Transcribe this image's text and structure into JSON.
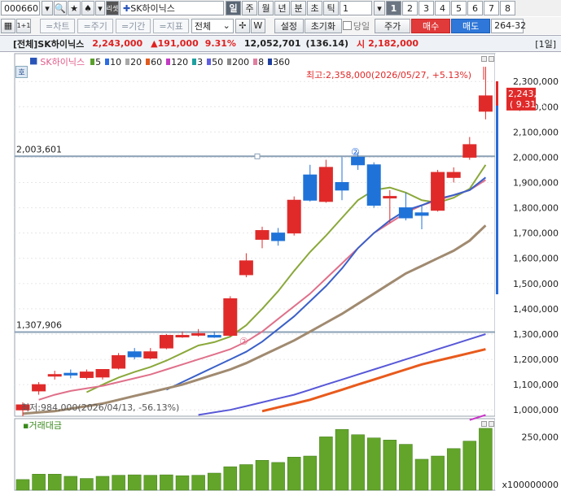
{
  "toolbar": {
    "stock_code": "000660",
    "stock_name": "SK하이닉스",
    "period_buttons": [
      "일",
      "주",
      "월",
      "년",
      "분",
      "초",
      "틱"
    ],
    "period_value": "1",
    "num_buttons": [
      "1",
      "2",
      "3",
      "4",
      "5",
      "6",
      "7",
      "8"
    ],
    "market_filter": "전체",
    "setting_label": "설정",
    "reset_label": "초기화",
    "day_label": "당일",
    "price_label": "주가",
    "buy_label": "매수",
    "sell_label": "매도",
    "right_value": "264-32",
    "chart_btn": "=차트",
    "period_btn": "=주기",
    "range_btn": "=기간",
    "indicator_btn": "=지표",
    "re_label": "리셋"
  },
  "info": {
    "market": "[전체]",
    "name": "SK하이닉스",
    "price": "2,243,000",
    "change": "▲191,000",
    "change_pct": "9.31%",
    "volume": "12,052,701",
    "volume_ratio": "(136.14)",
    "open_label": "시",
    "open_price": "2,182,000",
    "period_tag": "[1일]"
  },
  "legend": {
    "name": "SK하이닉스",
    "periods": [
      "5",
      "10",
      "20",
      "60",
      "120",
      "3",
      "50",
      "200",
      "8",
      "360"
    ],
    "colors": [
      "#5aa02c",
      "#2e6ce0",
      "#a8a8a8",
      "#e05a1e",
      "#c23ac2",
      "#1ea0a0",
      "#6060e0",
      "#8a8a8a",
      "#e080a0",
      "#2040a0"
    ]
  },
  "annotations": {
    "high_label": "최고:2,358,000(2026/05/27, +5.13%)",
    "low_label": "최저:984,000(2026/04/13, -56.13%)",
    "marker_2_top": "②",
    "marker_2_low": "②",
    "hline_upper": "2,003,601",
    "hline_lower": "1,307,906",
    "side_label": "호"
  },
  "price_axis": {
    "ticks": [
      "2,300,000",
      "2,200,000",
      "2,100,000",
      "2,000,000",
      "1,900,000",
      "1,800,000",
      "1,700,000",
      "1,600,000",
      "1,500,000",
      "1,400,000",
      "1,300,000",
      "1,200,000",
      "1,100,000",
      "1,000,000"
    ],
    "current_price": "2,243,000",
    "current_pct": "( 9.31%)"
  },
  "volume_panel": {
    "title": "거래대금",
    "tick": "250,000",
    "unit": "x100000000"
  },
  "chart_data": {
    "type": "candlestick",
    "ylim": [
      980000,
      2400000
    ],
    "candles": [
      {
        "o": 1000000,
        "h": 1030000,
        "l": 975000,
        "c": 1020000
      },
      {
        "o": 1075000,
        "h": 1110000,
        "l": 1060000,
        "c": 1100000
      },
      {
        "o": 1135000,
        "h": 1155000,
        "l": 1120000,
        "c": 1140000
      },
      {
        "o": 1145000,
        "h": 1160000,
        "l": 1125000,
        "c": 1138000
      },
      {
        "o": 1128000,
        "h": 1160000,
        "l": 1120000,
        "c": 1150000
      },
      {
        "o": 1130000,
        "h": 1160000,
        "l": 1120000,
        "c": 1160000
      },
      {
        "o": 1165000,
        "h": 1225000,
        "l": 1160000,
        "c": 1215000
      },
      {
        "o": 1230000,
        "h": 1245000,
        "l": 1200000,
        "c": 1210000
      },
      {
        "o": 1205000,
        "h": 1245000,
        "l": 1200000,
        "c": 1230000
      },
      {
        "o": 1245000,
        "h": 1300000,
        "l": 1240000,
        "c": 1295000
      },
      {
        "o": 1290000,
        "h": 1310000,
        "l": 1285000,
        "c": 1295000
      },
      {
        "o": 1300000,
        "h": 1320000,
        "l": 1290000,
        "c": 1302000
      },
      {
        "o": 1295000,
        "h": 1310000,
        "l": 1285000,
        "c": 1288000
      },
      {
        "o": 1295000,
        "h": 1450000,
        "l": 1290000,
        "c": 1440000
      },
      {
        "o": 1535000,
        "h": 1620000,
        "l": 1525000,
        "c": 1590000
      },
      {
        "o": 1675000,
        "h": 1725000,
        "l": 1640000,
        "c": 1710000
      },
      {
        "o": 1700000,
        "h": 1720000,
        "l": 1650000,
        "c": 1670000
      },
      {
        "o": 1700000,
        "h": 1845000,
        "l": 1690000,
        "c": 1830000
      },
      {
        "o": 1930000,
        "h": 1970000,
        "l": 1825000,
        "c": 1830000
      },
      {
        "o": 1825000,
        "h": 1990000,
        "l": 1820000,
        "c": 1960000
      },
      {
        "o": 1900000,
        "h": 2000000,
        "l": 1830000,
        "c": 1870000
      },
      {
        "o": 2000000,
        "h": 2020000,
        "l": 1950000,
        "c": 1970000
      },
      {
        "o": 1970000,
        "h": 1980000,
        "l": 1800000,
        "c": 1810000
      },
      {
        "o": 1840000,
        "h": 1870000,
        "l": 1740000,
        "c": 1845000
      },
      {
        "o": 1800000,
        "h": 1860000,
        "l": 1750000,
        "c": 1760000
      },
      {
        "o": 1780000,
        "h": 1810000,
        "l": 1715000,
        "c": 1770000
      },
      {
        "o": 1790000,
        "h": 1950000,
        "l": 1785000,
        "c": 1940000
      },
      {
        "o": 1920000,
        "h": 1960000,
        "l": 1900000,
        "c": 1940000
      },
      {
        "o": 2000000,
        "h": 2080000,
        "l": 1990000,
        "c": 2050000
      },
      {
        "o": 2182000,
        "h": 2358000,
        "l": 2150000,
        "c": 2243000
      }
    ],
    "volumes": [
      50,
      75,
      75,
      65,
      55,
      65,
      70,
      72,
      70,
      72,
      68,
      70,
      80,
      110,
      120,
      140,
      130,
      155,
      160,
      250,
      285,
      260,
      245,
      235,
      215,
      145,
      160,
      195,
      230,
      290
    ],
    "volume_max": 320,
    "ma_lines": [
      {
        "name": "5",
        "color": "#8aa83a",
        "values": [
          null,
          null,
          null,
          null,
          1070000,
          1100000,
          1128000,
          1150000,
          1170000,
          1195000,
          1225000,
          1255000,
          1268000,
          1290000,
          1335000,
          1400000,
          1470000,
          1550000,
          1625000,
          1690000,
          1760000,
          1830000,
          1870000,
          1880000,
          1860000,
          1830000,
          1820000,
          1840000,
          1875000,
          1970000
        ]
      },
      {
        "name": "20",
        "color": "#e0708a",
        "values": [
          null,
          1040000,
          1060000,
          1075000,
          1085000,
          1095000,
          1110000,
          1125000,
          1140000,
          1160000,
          1180000,
          1200000,
          1220000,
          1240000,
          1270000,
          1310000,
          1360000,
          1410000,
          1460000,
          1520000,
          1580000,
          1640000,
          1700000,
          1740000,
          1780000,
          1810000,
          1830000,
          1850000,
          1870000,
          1910000
        ]
      },
      {
        "name": "10",
        "color": "#3a60c8",
        "values": [
          null,
          null,
          null,
          null,
          null,
          null,
          null,
          null,
          null,
          1080000,
          1110000,
          1140000,
          1170000,
          1200000,
          1230000,
          1270000,
          1320000,
          1370000,
          1430000,
          1490000,
          1560000,
          1640000,
          1700000,
          1750000,
          1790000,
          1810000,
          1835000,
          1850000,
          1870000,
          1920000
        ]
      },
      {
        "name": "60",
        "color": "#a08a70",
        "values": [
          985000,
          990000,
          995000,
          1005000,
          1015000,
          1025000,
          1040000,
          1055000,
          1070000,
          1085000,
          1100000,
          1120000,
          1140000,
          1160000,
          1185000,
          1215000,
          1245000,
          1275000,
          1310000,
          1345000,
          1380000,
          1420000,
          1460000,
          1500000,
          1540000,
          1570000,
          1600000,
          1630000,
          1670000,
          1730000
        ]
      },
      {
        "name": "120",
        "color": "#5858d8",
        "values": [
          null,
          null,
          null,
          null,
          null,
          null,
          null,
          null,
          null,
          null,
          null,
          980000,
          990000,
          1000000,
          1015000,
          1030000,
          1045000,
          1060000,
          1080000,
          1100000,
          1120000,
          1140000,
          1160000,
          1180000,
          1200000,
          1220000,
          1240000,
          1260000,
          1280000,
          1300000
        ]
      },
      {
        "name": "200",
        "color": "#e85a1c",
        "values": [
          null,
          null,
          null,
          null,
          null,
          null,
          null,
          null,
          null,
          null,
          null,
          null,
          null,
          null,
          null,
          995000,
          1010000,
          1025000,
          1040000,
          1060000,
          1080000,
          1100000,
          1120000,
          1140000,
          1160000,
          1180000,
          1195000,
          1210000,
          1225000,
          1240000
        ]
      },
      {
        "name": "360",
        "color": "#c830c8",
        "values": [
          null,
          null,
          null,
          null,
          null,
          null,
          null,
          null,
          null,
          null,
          null,
          null,
          null,
          null,
          null,
          null,
          null,
          null,
          null,
          null,
          null,
          null,
          null,
          null,
          null,
          null,
          null,
          null,
          960000,
          980000
        ]
      }
    ]
  }
}
